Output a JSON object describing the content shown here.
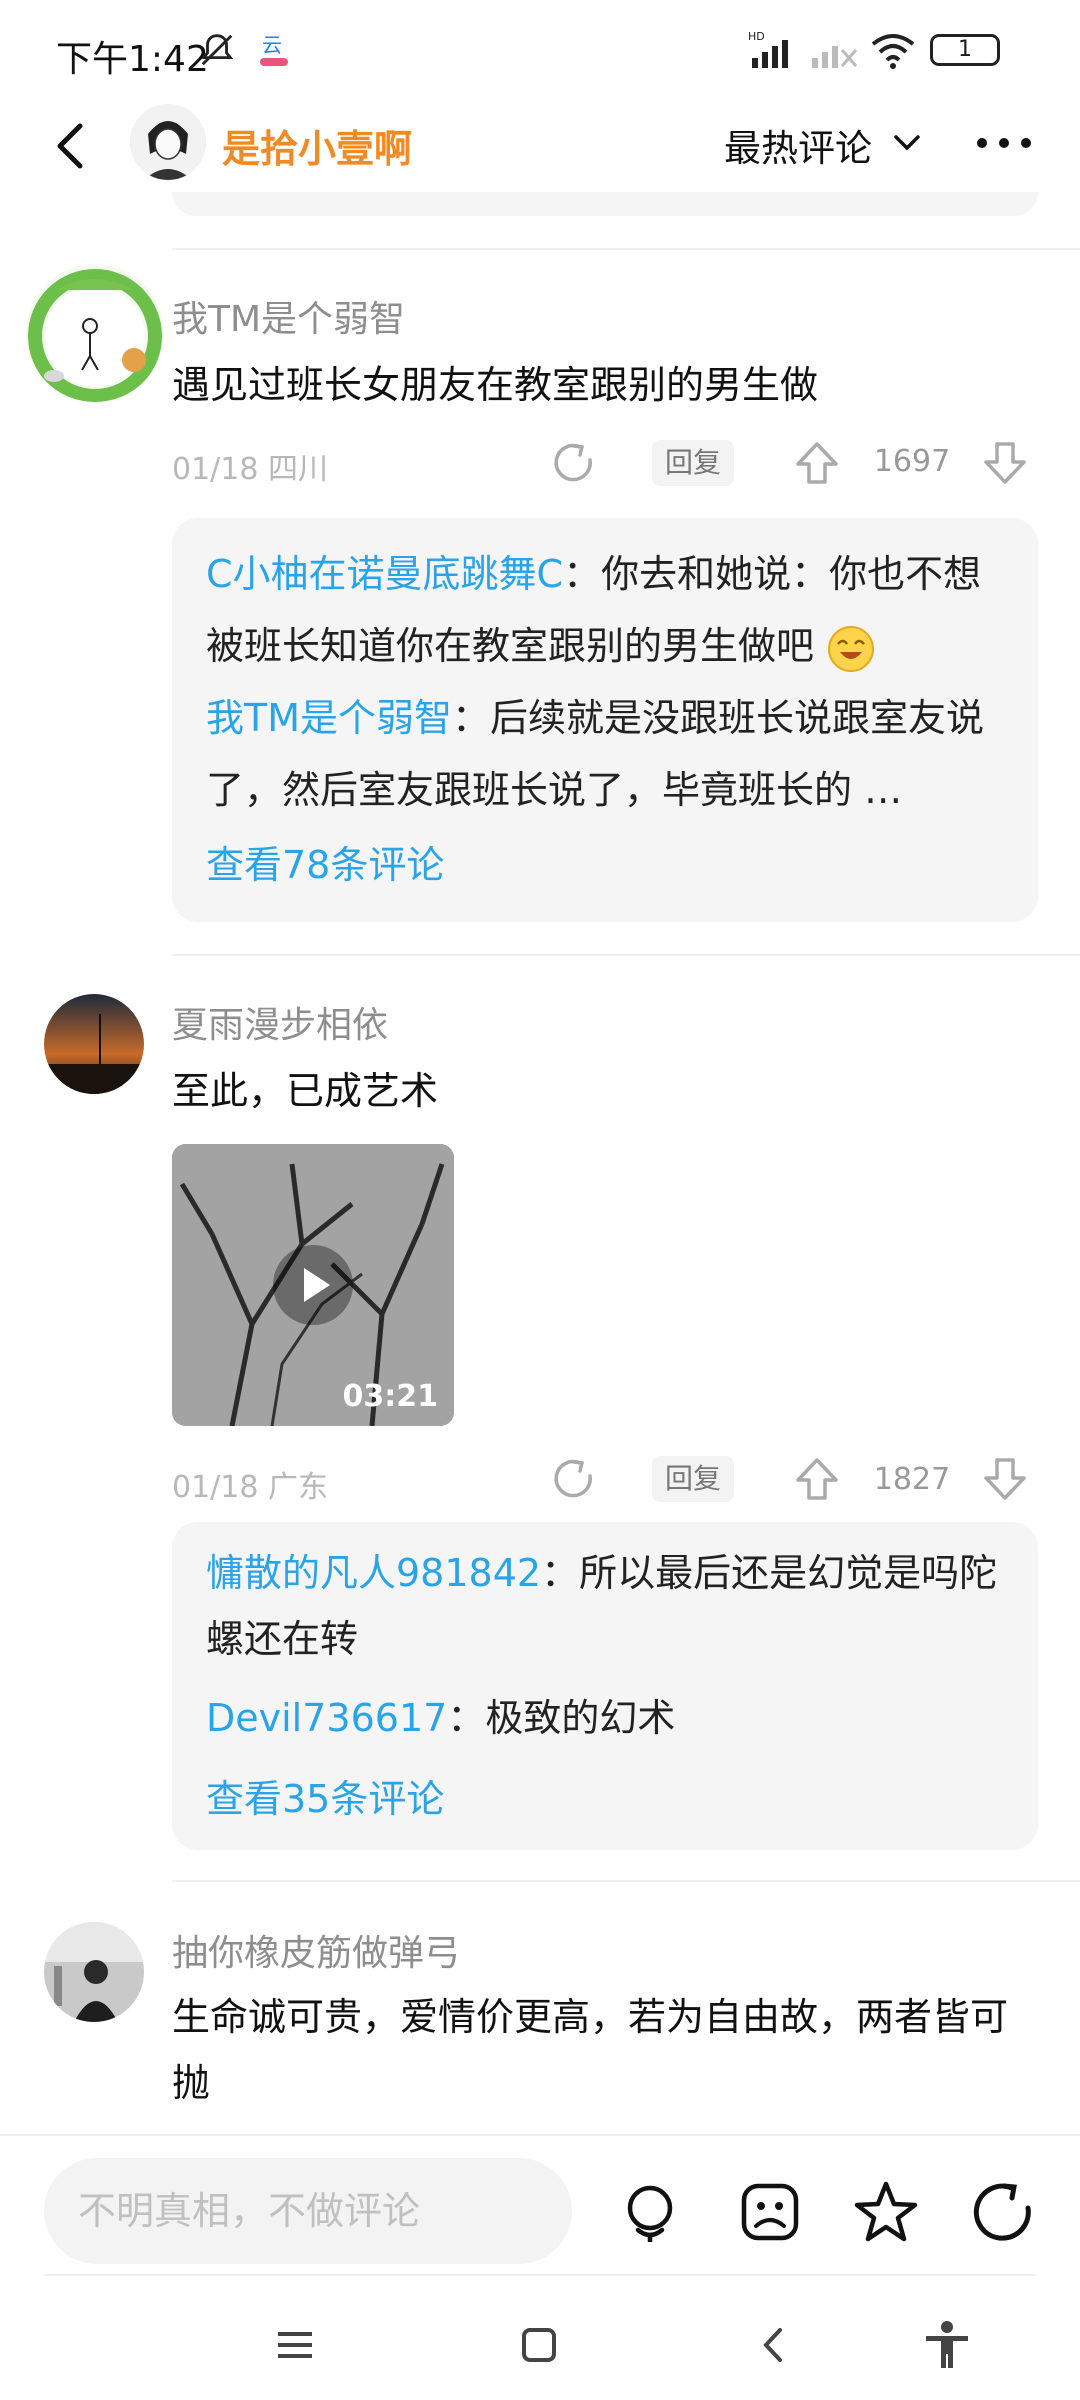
{
  "status_bar": {
    "time": "下午1:42",
    "icons": [
      "mute-icon",
      "app-notification-icon",
      "hd-signal-icon",
      "no-signal-icon",
      "wifi-icon",
      "battery-icon"
    ],
    "battery_level": "1"
  },
  "header": {
    "back_icon": "chevron-left-icon",
    "poster_name": "是拾小壹啊",
    "sort_label": "最热评论",
    "more_icon": "more-dots-icon",
    "name_color": "#F08A24"
  },
  "comments": [
    {
      "username": "我TM是个弱智",
      "text": "遇见过班长女朋友在教室跟别的男生做",
      "date": "01/18",
      "location": "四川",
      "reply_label": "回复",
      "vote_count": "1697",
      "replies": [
        {
          "user": "C小柚在诺曼底跳舞C",
          "text": "：你去和她说：你也不想被班长知道你在教室跟别的男生做吧"
        },
        {
          "user": "我TM是个弱智",
          "text": "：后续就是没跟班长说跟室友说了，然后室友跟班长说了，毕竟班长的 …"
        }
      ],
      "view_more": "查看78条评论"
    },
    {
      "username": "夏雨漫步相依",
      "text": "至此，已成艺术",
      "video_duration": "03:21",
      "date": "01/18",
      "location": "广东",
      "reply_label": "回复",
      "vote_count": "1827",
      "replies": [
        {
          "user": "慵散的凡人981842",
          "text": "：所以最后还是幻觉是吗陀螺还在转"
        },
        {
          "user": "Devil736617",
          "text": "：极致的幻术"
        }
      ],
      "view_more": "查看35条评论"
    },
    {
      "username": "抽你橡皮筋做弹弓",
      "text": "生命诚可贵，爱情价更高，若为自由故，两者皆可抛"
    }
  ],
  "bottom_bar": {
    "input_placeholder": "不明真相，不做评论",
    "icons": [
      "voice-icon",
      "image-icon",
      "star-icon",
      "share-icon"
    ]
  },
  "system_nav": [
    "menu-icon",
    "home-icon",
    "back-icon",
    "accessibility-icon"
  ],
  "colors": {
    "link_blue": "#2AA4E8",
    "reply_box_bg": "#F5F5F5"
  }
}
